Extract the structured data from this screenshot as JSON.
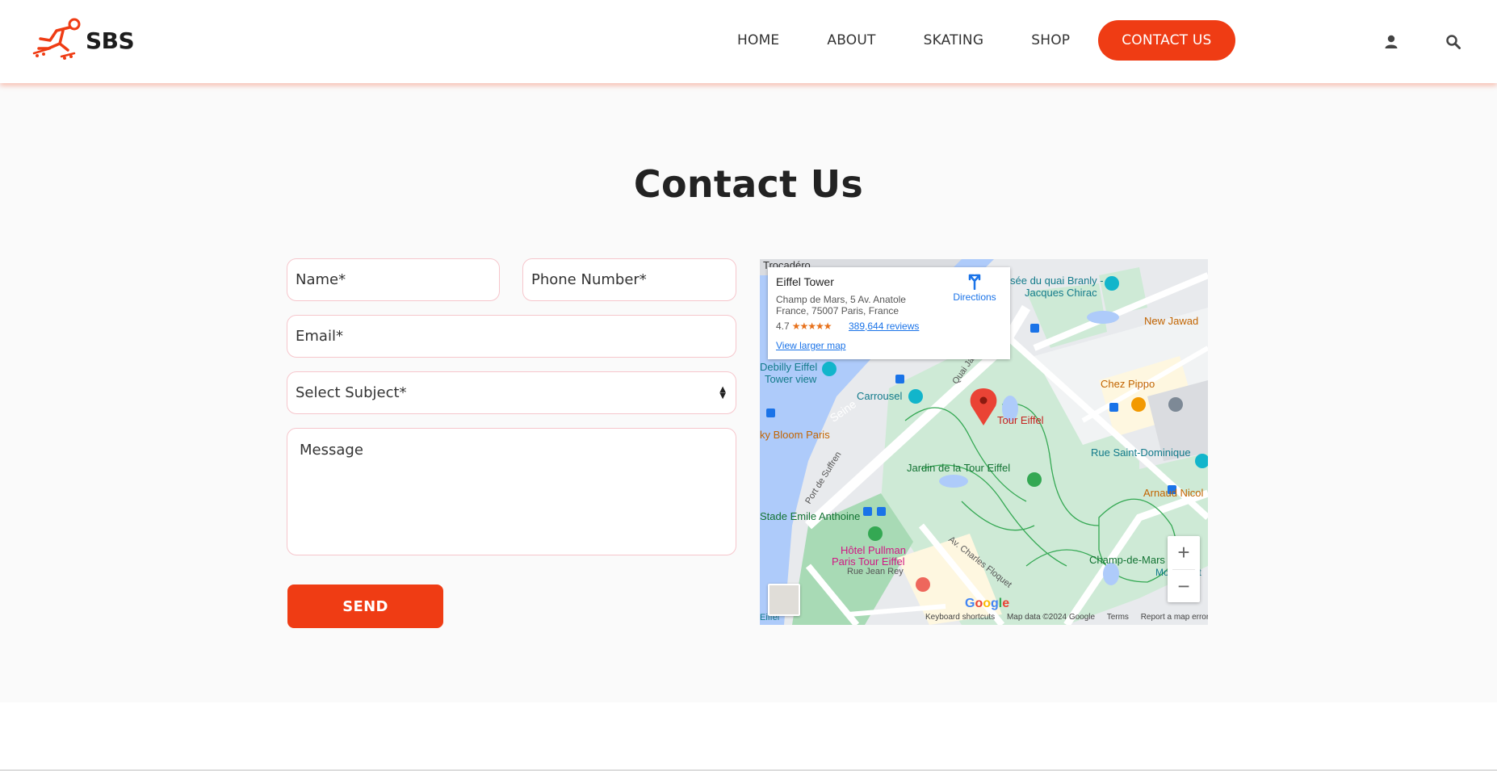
{
  "brand": {
    "name": "SBS",
    "accent": "#ef3c14"
  },
  "nav": {
    "items": [
      "HOME",
      "ABOUT",
      "SKATING",
      "SHOP"
    ],
    "cta": "CONTACT US"
  },
  "icons": {
    "user": "user-icon",
    "search": "search-icon"
  },
  "page": {
    "title": "Contact Us"
  },
  "form": {
    "name_placeholder": "Name*",
    "phone_placeholder": "Phone Number*",
    "email_placeholder": "Email*",
    "subject_selected": "Select Subject*",
    "message_placeholder": "Message",
    "send_label": "SEND"
  },
  "map": {
    "place_name": "Eiffel Tower",
    "address": "Champ de Mars, 5 Av. Anatole France, 75007 Paris, France",
    "rating": "4.7",
    "stars": "★★★★★",
    "reviews": "389,644 reviews",
    "larger_map": "View larger map",
    "directions": "Directions",
    "zoom_in": "+",
    "zoom_out": "−",
    "labels": {
      "trocadero": "Trocadéro",
      "musee": "sée du quai Branly -",
      "jacques": "Jacques Chirac",
      "new_jawad": "New Jawad",
      "debilly": "Debilly Eiffel",
      "tower_view": "Tower view",
      "carrousel": "Carrousel",
      "seine": "Seine",
      "quai": "Quai Jac",
      "chez_pippo": "Chez Pippo",
      "tour_eiffel": "Tour Eiffel",
      "sky_bloom": "ky Bloom Paris",
      "rue_saint": "Rue Saint-Dominique",
      "port_suffren": "Port de Suffren",
      "jardin": "Jardin de la Tour Eiffel",
      "arnaud": "Arnaud Nicol",
      "stade": "Stade Emile Anthoine",
      "av_charles": "Av. Charles Floquet",
      "hotel1": "Hôtel Pullman",
      "hotel2": "Paris Tour Eiffel",
      "champ": "Champ-de-Mars",
      "monument": "Monument",
      "rue_jean": "Rue Jean Rey",
      "eiffel_bottom": "Eiffel"
    },
    "footer": {
      "shortcuts": "Keyboard shortcuts",
      "data": "Map data ©2024 Google",
      "terms": "Terms",
      "report": "Report a map error"
    },
    "google": "Google"
  }
}
